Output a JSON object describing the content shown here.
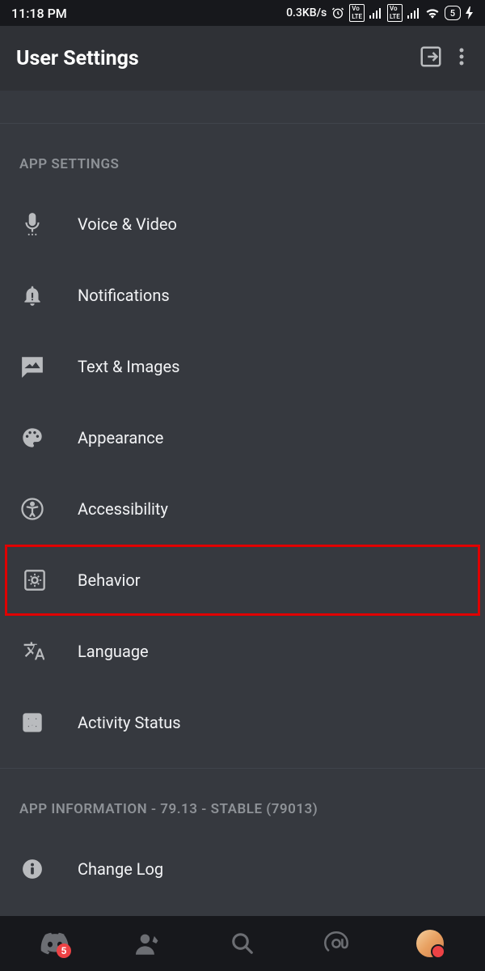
{
  "status_bar": {
    "time": "11:18 PM",
    "network_speed": "0.3KB/s",
    "battery": "5"
  },
  "header": {
    "title": "User Settings"
  },
  "sections": {
    "app_settings": {
      "header": "APP SETTINGS",
      "items": [
        {
          "label": "Voice & Video"
        },
        {
          "label": "Notifications"
        },
        {
          "label": "Text & Images"
        },
        {
          "label": "Appearance"
        },
        {
          "label": "Accessibility"
        },
        {
          "label": "Behavior"
        },
        {
          "label": "Language"
        },
        {
          "label": "Activity Status"
        }
      ]
    },
    "app_info": {
      "header": "APP INFORMATION - 79.13 - STABLE (79013)",
      "items": [
        {
          "label": "Change Log"
        }
      ]
    }
  },
  "bottom_nav": {
    "badge_count": "5"
  }
}
